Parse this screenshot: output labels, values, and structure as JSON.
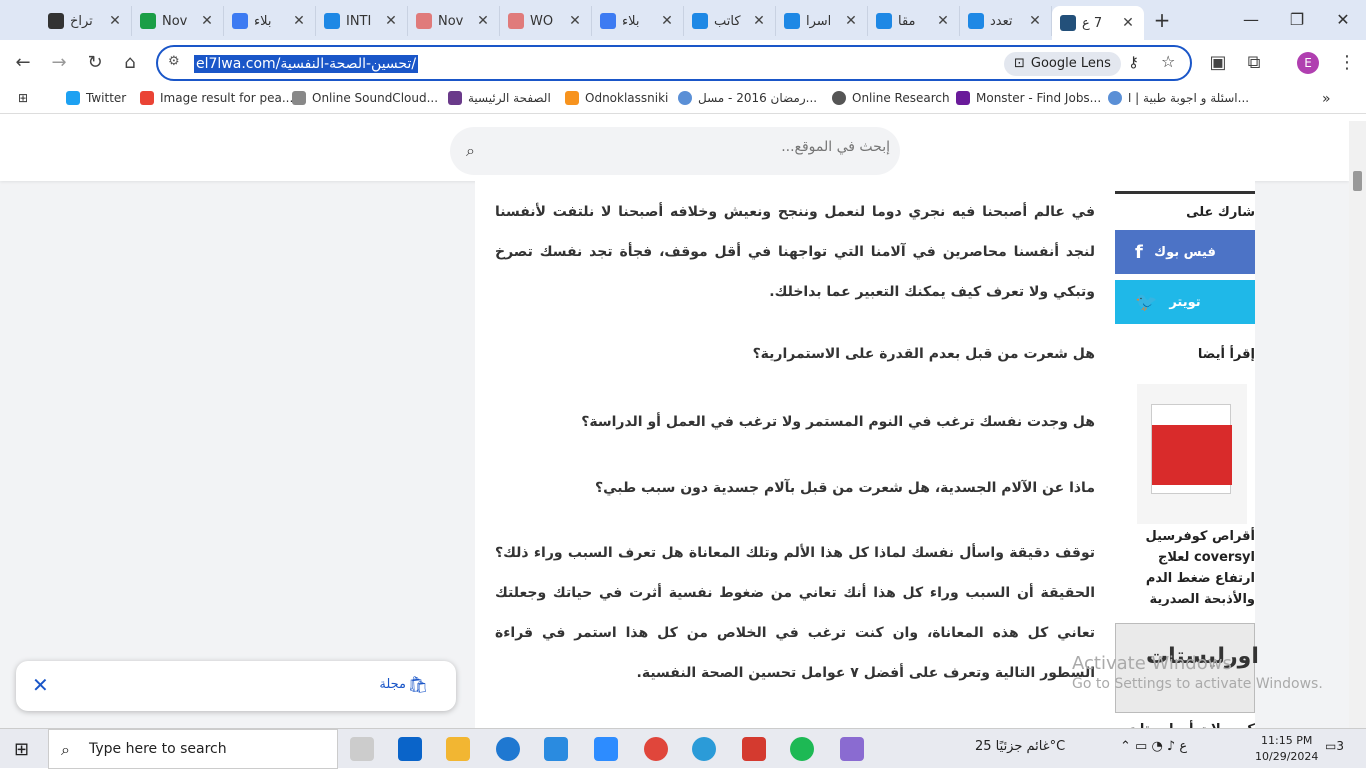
{
  "tabs": [
    {
      "title": "تراخ",
      "fav": "#333"
    },
    {
      "title": "Nov",
      "fav": "#1a9e46"
    },
    {
      "title": "بلاء",
      "fav": "#3d7bf2"
    },
    {
      "title": "INTI",
      "fav": "#1e88e5"
    },
    {
      "title": "Nov",
      "fav": "#e07b7b"
    },
    {
      "title": "WO",
      "fav": "#e07b7b"
    },
    {
      "title": "بلاء",
      "fav": "#3d7bf2"
    },
    {
      "title": "كاتب",
      "fav": "#1e88e5"
    },
    {
      "title": "اسرا",
      "fav": "#1e88e5"
    },
    {
      "title": "مقا",
      "fav": "#1e88e5"
    },
    {
      "title": "تعدد",
      "fav": "#1e88e5"
    },
    {
      "title": "7 ع",
      "fav": "#23507a",
      "active": true
    }
  ],
  "address": {
    "url": "el7lwa.com/تحسين-الصحة-النفسية/",
    "lens": "Google Lens"
  },
  "bookmarks": [
    {
      "label": "Twitter"
    },
    {
      "label": "Image result for pea..."
    },
    {
      "label": "Online SoundCloud..."
    },
    {
      "label": "الصفحة الرئيسية"
    },
    {
      "label": "Odnoklassniki"
    },
    {
      "label": "رمضان 2016 - مسل..."
    },
    {
      "label": "Online Research"
    },
    {
      "label": "Monster - Find Jobs..."
    },
    {
      "label": "اسئلة و اجوبة طبية | ا..."
    }
  ],
  "site": {
    "search_placeholder": "إبحث في الموقع...",
    "intro": "في عالم أصبحنا فيه نجري دوما لنعمل وننجح ونعيش وخلافه أصبحنا لا نلتفت لأنفسنا لنجد أنفسنا محاصرين في آلامنا التي تواجهنا في أقل موقف، فجأة تجد نفسك تصرخ وتبكي ولا تعرف كيف يمكنك التعبير عما بداخلك.",
    "q1": "هل شعرت من قبل بعدم القدرة على الاستمرارية؟",
    "q2": "هل وجدت نفسك ترغب في النوم المستمر ولا ترغب في العمل أو الدراسة؟",
    "q3": "ماذا عن الآلام الجسدية، هل شعرت من قبل بآلام جسدية دون سبب طبي؟",
    "body": "توقف دقيقة واسأل نفسك لماذا كل هذا الألم وتلك المعاناة هل تعرف السبب وراء ذلك؟ الحقيقة أن السبب وراء كل هذا أنك تعاني من ضغوط نفسية أثرت في حياتك وجعلتك تعاني كل هذه المعاناة، وان كنت ترغب في الخلاص من كل هذا استمر في قراءة السطور التالية وتعرف على أفضل ٧ عوامل تحسين الصحة النفسية.",
    "share_title": "شارك على",
    "facebook": "فيس بوك",
    "twitter": "تويتر",
    "read_also": "إقرأ أيضا",
    "related1": "أقراص كوفرسيل coversyl لعلاج ارتفاع ضغط الدم والأذبحة الصدرية",
    "img2_text": "اورليستات",
    "related2": "كبسولات أورليستات"
  },
  "toast": {
    "label": "مجلة"
  },
  "watermark": {
    "line1": "Activate Windows",
    "line2": "Go to Settings to activate Windows."
  },
  "taskbar": {
    "search": "Type here to search",
    "weather": "غائم جزئيًا  25°C",
    "time": "11:15 PM",
    "date": "10/29/2024",
    "notifications": "3"
  }
}
